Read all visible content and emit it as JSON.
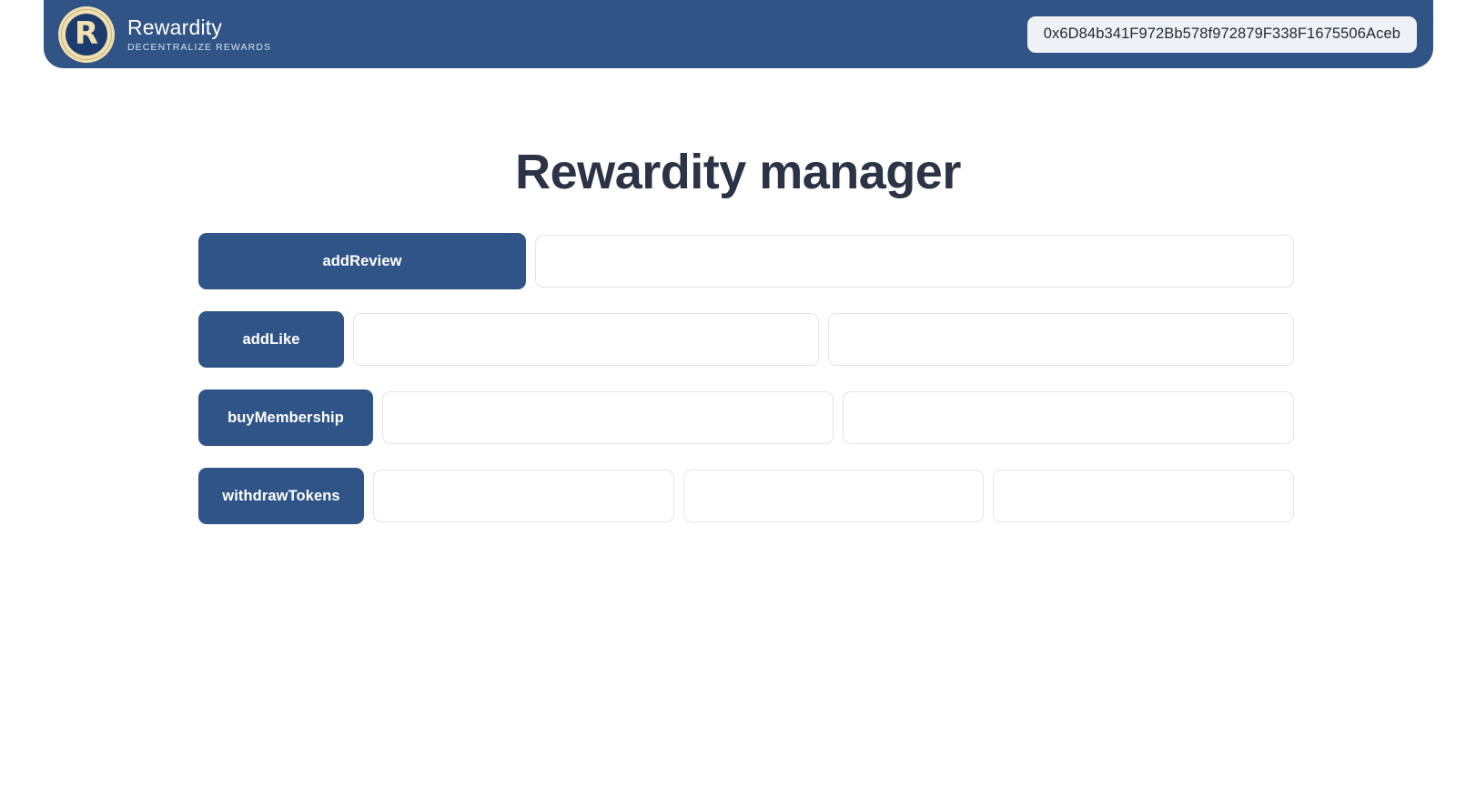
{
  "header": {
    "logo": {
      "icon": "rewardity-coin-logo",
      "letter": "R"
    },
    "brand_name": "Rewardity",
    "tagline": "DECENTRALIZE REWARDS",
    "wallet_address": "0x6D84b341F972Bb578f972879F338F1675506Aceb",
    "background_color": "#2f5485"
  },
  "main": {
    "title": "Rewardity manager",
    "title_color": "#2b3446",
    "accent_color": "#2f5488",
    "rows": [
      {
        "button_label": "addReview",
        "button_width": 360,
        "inputs": [
          {
            "value": "",
            "placeholder": ""
          }
        ]
      },
      {
        "button_label": "addLike",
        "button_width": 160,
        "inputs": [
          {
            "value": "",
            "placeholder": ""
          },
          {
            "value": "",
            "placeholder": ""
          }
        ]
      },
      {
        "button_label": "buyMembership",
        "button_width": 192,
        "inputs": [
          {
            "value": "",
            "placeholder": ""
          },
          {
            "value": "",
            "placeholder": ""
          }
        ]
      },
      {
        "button_label": "withdrawTokens",
        "button_width": 182,
        "inputs": [
          {
            "value": "",
            "placeholder": ""
          },
          {
            "value": "",
            "placeholder": ""
          },
          {
            "value": "",
            "placeholder": ""
          }
        ]
      }
    ]
  }
}
